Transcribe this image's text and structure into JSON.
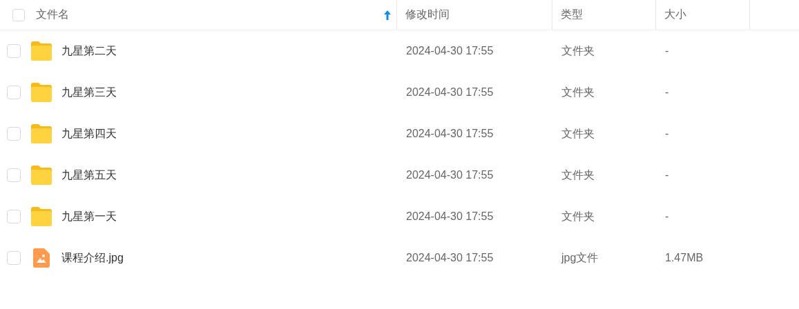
{
  "table": {
    "all_checked": false,
    "columns": [
      {
        "label": "文件名",
        "sorted": true
      },
      {
        "label": "修改时间",
        "sorted": false
      },
      {
        "label": "类型",
        "sorted": false
      },
      {
        "label": "大小",
        "sorted": false
      }
    ],
    "rows": [
      {
        "kind": "folder",
        "checked": false,
        "name": "九星第二天",
        "modified": "2024-04-30 17:55",
        "type": "文件夹",
        "size": "-"
      },
      {
        "kind": "folder",
        "checked": false,
        "name": "九星第三天",
        "modified": "2024-04-30 17:55",
        "type": "文件夹",
        "size": "-"
      },
      {
        "kind": "folder",
        "checked": false,
        "name": "九星第四天",
        "modified": "2024-04-30 17:55",
        "type": "文件夹",
        "size": "-"
      },
      {
        "kind": "folder",
        "checked": false,
        "name": "九星第五天",
        "modified": "2024-04-30 17:55",
        "type": "文件夹",
        "size": "-"
      },
      {
        "kind": "folder",
        "checked": false,
        "name": "九星第一天",
        "modified": "2024-04-30 17:55",
        "type": "文件夹",
        "size": "-"
      },
      {
        "kind": "image",
        "checked": false,
        "name": "课程介绍.jpg",
        "modified": "2024-04-30 17:55",
        "type": "jpg文件",
        "size": "1.47MB"
      }
    ]
  }
}
